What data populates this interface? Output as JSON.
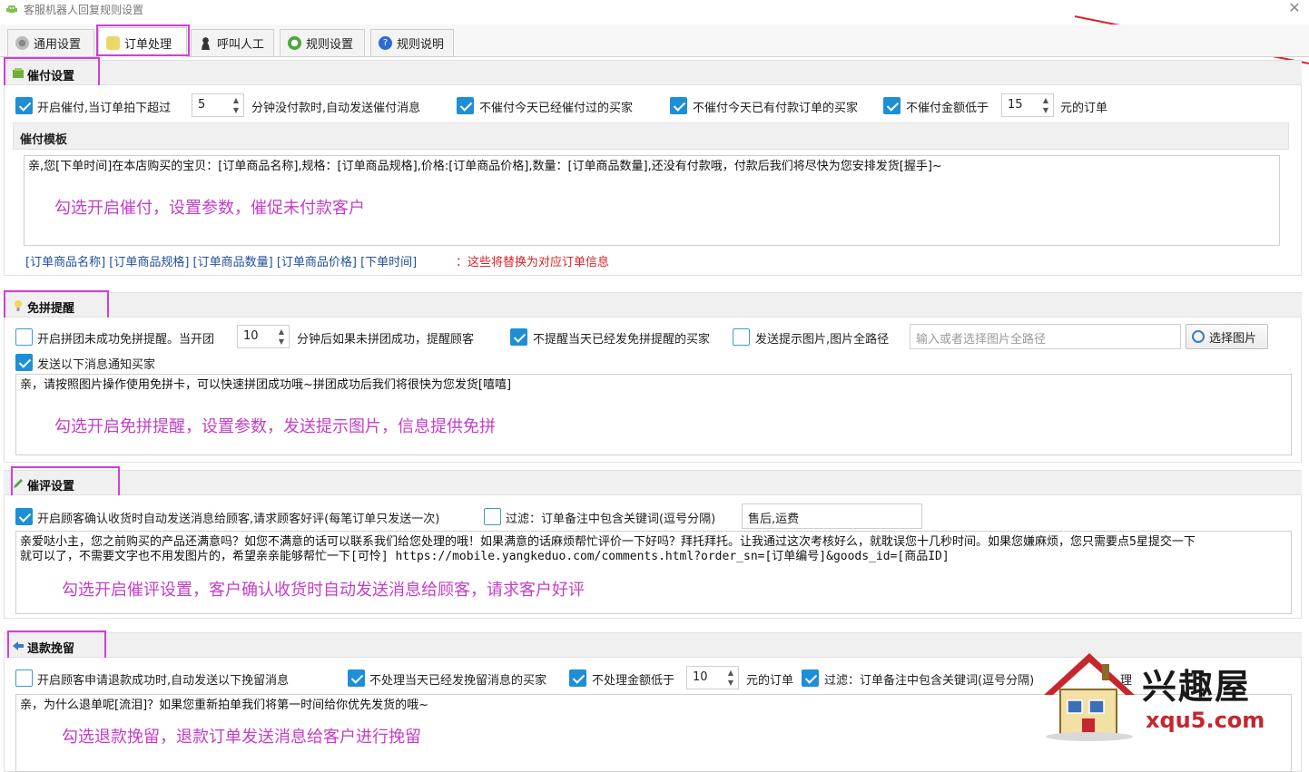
{
  "window": {
    "title": "客服机器人回复规则设置",
    "close": "✕"
  },
  "tabs": [
    {
      "label": "通用设置"
    },
    {
      "label": "订单处理"
    },
    {
      "label": "呼叫人工"
    },
    {
      "label": "规则设置"
    },
    {
      "label": "规则说明"
    }
  ],
  "payment": {
    "header": "催付设置",
    "enable_label": "开启催付,当订单拍下超过",
    "minutes_value": "5",
    "minutes_suffix": "分钟没付款时,自动发送催付消息",
    "skip_today_label": "不催付今天已经催付过的买家",
    "skip_paid_label": "不催付今天已有付款订单的买家",
    "skip_amount_label": "不催付金额低于",
    "amount_value": "15",
    "amount_suffix": "元的订单",
    "template_title": "催付模板",
    "template_text": "亲,您[下单时间]在本店购买的宝贝：[订单商品名称],规格：[订单商品规格],价格:[订单商品价格],数量：[订单商品数量],还没有付款哦，付款后我们将尽快为您安排发货[握手]~",
    "overlay": "勾选开启催付，设置参数，催促未付款客户",
    "vars": "[订单商品名称] [订单商品规格] [订单商品数量] [订单商品价格] [下单时间]",
    "vars_note": "：这些将替换为对应订单信息"
  },
  "group": {
    "header": "免拼提醒",
    "enable_label": "开启拼团未成功免拼提醒。当开团",
    "minutes_value": "10",
    "minutes_suffix": "分钟后如果未拼团成功，提醒顾客",
    "skip_today_label": "不提醒当天已经发免拼提醒的买家",
    "send_image_label": "发送提示图片,图片全路径",
    "image_placeholder": "输入或者选择图片全路径",
    "choose_button": "选择图片",
    "send_msg_label": "发送以下消息通知买家",
    "message_text": "亲，请按照图片操作使用免拼卡，可以快速拼团成功哦~拼团成功后我们将很快为您发货[嘻嘻]",
    "overlay": "勾选开启免拼提醒，设置参数，发送提示图片，信息提供免拼"
  },
  "review": {
    "header": "催评设置",
    "enable_label": "开启顾客确认收货时自动发送消息给顾客,请求顾客好评(每笔订单只发送一次)",
    "filter_label": "过滤：订单备注中包含关键词(逗号分隔)",
    "filter_value": "售后,运费",
    "message_line1": "亲爱哒小主，您之前购买的产品还满意吗？如您不满意的话可以联系我们给您处理的哦！如果满意的话麻烦帮忙评价一下好吗？拜托拜托。让我通过这次考核好么，就耽误您十几秒时间。如果您嫌麻烦，您只需要点5星提交一下",
    "message_line2": "就可以了，不需要文字也不用发图片的，希望亲亲能够帮忙一下[可怜]  https://mobile.yangkeduo.com/comments.html?order_sn=[订单编号]&goods_id=[商品ID]",
    "overlay": "勾选开启催评设置，客户确认收货时自动发送消息给顾客，请求客户好评"
  },
  "refund": {
    "header": "退款挽留",
    "enable_label": "开启顾客申请退款成功时,自动发送以下挽留消息",
    "skip_today_label": "不处理当天已经发挽留消息的买家",
    "skip_amount_label": "不处理金额低于",
    "amount_value": "10",
    "amount_suffix": "元的订单",
    "filter_label": "过滤：订单备注中包含关键词(逗号分隔)",
    "filter_tail": "理",
    "message_text": "亲，为什么退单呢[流泪]？如果您重新拍单我们将第一时间给你优先发货的哦~",
    "overlay": "勾选退款挽留，退款订单发送消息给客户进行挽留"
  },
  "watermark": {
    "brand": "兴趣屋",
    "domain": "xqu5.com"
  },
  "colors": {
    "accent": "#1e8fd6",
    "annotation": "#c43ec9",
    "highlight_box": "#d03fd8",
    "arrow": "#d9222a"
  }
}
